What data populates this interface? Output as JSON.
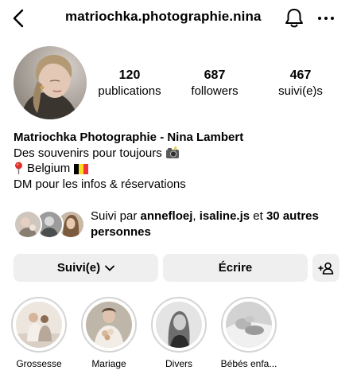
{
  "header": {
    "username": "matriochka.photographie.nina",
    "back_icon": "chevron-left-icon",
    "bell_icon": "bell-icon",
    "more_icon": "more-horizontal-icon"
  },
  "profile": {
    "stats": [
      {
        "value": "120",
        "label": "publications"
      },
      {
        "value": "687",
        "label": "followers"
      },
      {
        "value": "467",
        "label": "suivi(e)s"
      }
    ],
    "name": "Matriochka Photographie - Nina Lambert",
    "bio_lines": [
      "Des souvenirs pour toujours",
      "Belgium",
      "DM pour les infos & réservations"
    ]
  },
  "mutual": {
    "prefix": "Suivi par ",
    "user1": "annefloej",
    "sep": ", ",
    "user2": "isaline.js",
    "mid": " et ",
    "others": "30 autres personnes"
  },
  "buttons": {
    "following": "Suivi(e)",
    "message": "Écrire"
  },
  "highlights": [
    {
      "label": "Grossesse"
    },
    {
      "label": "Mariage"
    },
    {
      "label": "Divers"
    },
    {
      "label": "Bébés enfa..."
    }
  ],
  "colors": {
    "button_bg": "#efefef",
    "highlight_ring": "#d4d4d4",
    "belgium_flag": [
      "#000000",
      "#fdda24",
      "#ef3340"
    ],
    "pin_red": "#e0312c"
  }
}
